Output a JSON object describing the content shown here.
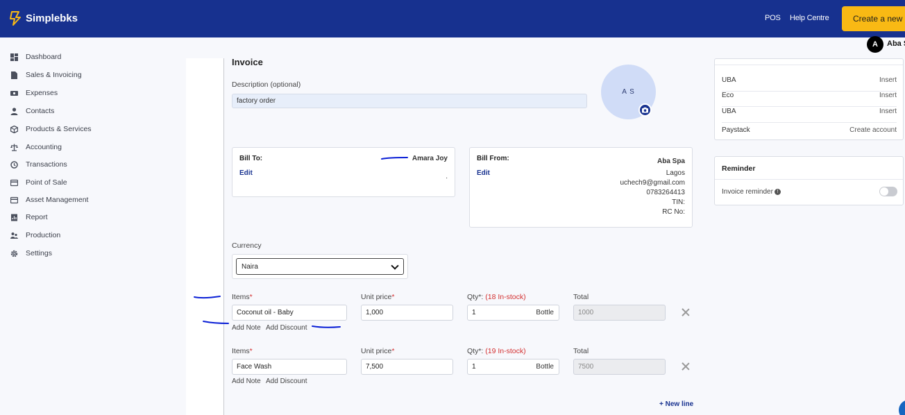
{
  "brand": {
    "name": "Simplebks"
  },
  "header": {
    "links": [
      "POS",
      "Help Centre"
    ],
    "create_label": "Create a new",
    "user_initial": "A",
    "user_name": "Aba Spa"
  },
  "sidebar": {
    "items": [
      {
        "label": "Dashboard",
        "icon": "dashboard-icon"
      },
      {
        "label": "Sales & Invoicing",
        "icon": "document-icon"
      },
      {
        "label": "Expenses",
        "icon": "money-icon"
      },
      {
        "label": "Contacts",
        "icon": "person-icon"
      },
      {
        "label": "Products & Services",
        "icon": "box-icon"
      },
      {
        "label": "Accounting",
        "icon": "scale-icon"
      },
      {
        "label": "Transactions",
        "icon": "history-icon"
      },
      {
        "label": "Point of Sale",
        "icon": "card-icon"
      },
      {
        "label": "Asset Management",
        "icon": "card-icon"
      },
      {
        "label": "Report",
        "icon": "report-icon"
      },
      {
        "label": "Production",
        "icon": "people-icon"
      },
      {
        "label": "Settings",
        "icon": "gear-icon"
      }
    ]
  },
  "invoice": {
    "title": "Invoice",
    "description_label": "Description (optional)",
    "description_value": "factory order",
    "logo_initials": "A S",
    "bill_to": {
      "label": "Bill To:",
      "name": "Amara Joy",
      "edit": "Edit",
      "extra": "."
    },
    "bill_from": {
      "label": "Bill From:",
      "name": "Aba Spa",
      "edit": "Edit",
      "city": "Lagos",
      "email": "uchech9@gmail.com",
      "phone": "0783264413",
      "tin": "TIN:",
      "rc": "RC No:"
    },
    "currency_label": "Currency",
    "currency_value": "Naira",
    "line_headers": {
      "items": "Items",
      "unit_price": "Unit price",
      "qty": "Qty*:",
      "total": "Total",
      "required_mark": "*"
    },
    "lines": [
      {
        "item": "Coconut oil - Baby",
        "unit_price": "1,000",
        "qty": "1",
        "unit": "Bottle",
        "total": "1000",
        "stock": "(18 In-stock)"
      },
      {
        "item": "Face Wash",
        "unit_price": "7,500",
        "qty": "1",
        "unit": "Bottle",
        "total": "7500",
        "stock": "(19 In-stock)"
      }
    ],
    "add_note": "Add Note",
    "add_discount": "Add Discount",
    "new_line": "+ New line"
  },
  "payment_accounts": [
    {
      "name": "UBA",
      "action": "Insert"
    },
    {
      "name": "Eco",
      "action": "Insert"
    },
    {
      "name": "UBA",
      "action": "Insert"
    },
    {
      "name": "Paystack",
      "action": "Create account"
    }
  ],
  "reminder": {
    "title": "Reminder",
    "label": "Invoice reminder",
    "info": "!",
    "enabled": false
  },
  "colors": {
    "brand_blue": "#17318f",
    "accent_yellow": "#f9b914",
    "stock_red": "#d32f2f"
  }
}
